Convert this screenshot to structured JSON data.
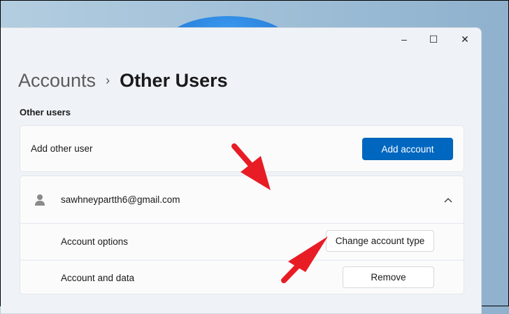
{
  "window": {
    "controls": {
      "minimize": "–",
      "maximize": "☐",
      "close": "✕"
    }
  },
  "breadcrumb": {
    "parent": "Accounts",
    "separator": "›",
    "current": "Other Users"
  },
  "section_title": "Other users",
  "add_user": {
    "label": "Add other user",
    "button": "Add account"
  },
  "user": {
    "email": "sawhneypartth6@gmail.com",
    "expanded_icon": "chevron-up-icon",
    "options": [
      {
        "label": "Account options",
        "button": "Change account type"
      },
      {
        "label": "Account and data",
        "button": "Remove"
      }
    ]
  },
  "colors": {
    "accent": "#0067c0",
    "annotation": "#e81c24"
  }
}
